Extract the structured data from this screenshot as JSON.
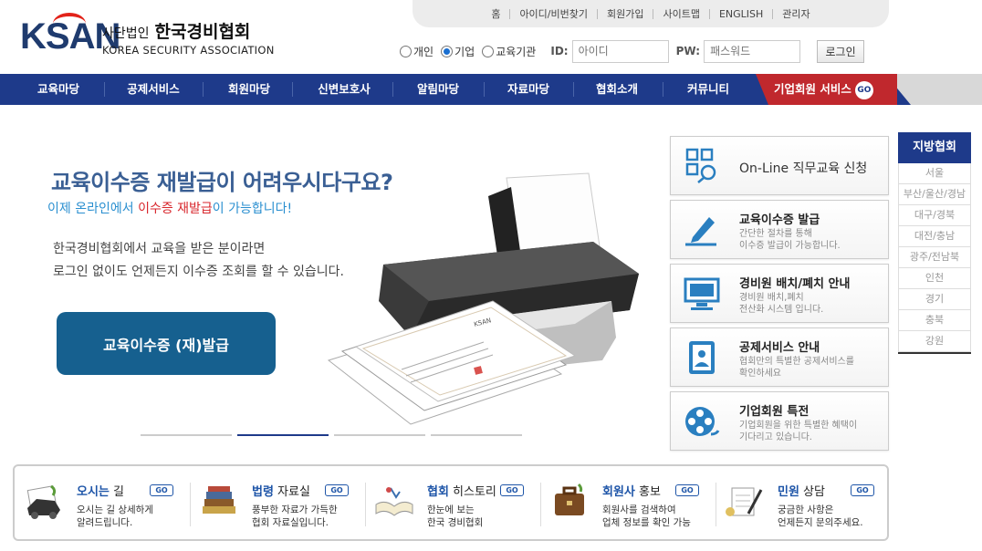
{
  "logo": {
    "ksan": "KSAN",
    "kr_small": "사단법인",
    "kr_name": "한국경비협회",
    "en": "KOREA SECURITY ASSOCIATION"
  },
  "topnav": [
    "홈",
    "아이디/비번찾기",
    "회원가입",
    "사이트맵",
    "ENGLISH",
    "관리자"
  ],
  "login": {
    "types": [
      {
        "label": "개인",
        "selected": false
      },
      {
        "label": "기업",
        "selected": true
      },
      {
        "label": "교육기관",
        "selected": false
      }
    ],
    "id_label": "ID:",
    "id_placeholder": "아이디",
    "pw_label": "PW:",
    "pw_placeholder": "패스워드",
    "button": "로그인"
  },
  "mainnav": [
    "교육마당",
    "공제서비스",
    "회원마당",
    "신변보호사",
    "알림마당",
    "자료마당",
    "협회소개",
    "커뮤니티"
  ],
  "corp_service": {
    "label": "기업회원 서비스",
    "go": "GO"
  },
  "hero": {
    "title": "교육이수증 재발급이 어려우시다구요?",
    "sub_pre": "이제 온라인에서 ",
    "sub_em": "이수증 재발급",
    "sub_post": "이 가능합니다!",
    "desc1": "한국경비협회에서 교육을 받은 분이라면",
    "desc2": "로그인 없이도 언제든지 이수증 조회를 할 수 있습니다.",
    "button": "교육이수증 (재)발급",
    "printer_logo": "KSAN"
  },
  "services": [
    {
      "title": "On-Line 직무교육 신청",
      "desc1": "",
      "desc2": "",
      "icon": "online-icon"
    },
    {
      "title": "교육이수증 발급",
      "desc1": "간단한 절차를 통해",
      "desc2": "이수증 발급이 가능합니다.",
      "icon": "pen-icon"
    },
    {
      "title": "경비원 배치/폐치 안내",
      "desc1": "경비원 배치,폐치",
      "desc2": "전산화 시스템 입니다.",
      "icon": "monitor-icon"
    },
    {
      "title": "공제서비스 안내",
      "desc1": "협회만의 특별한 공제서비스를",
      "desc2": "확인하세요",
      "icon": "book-icon"
    },
    {
      "title": "기업회원 특전",
      "desc1": "기업회원을 위한 특별한 혜택이",
      "desc2": "기다리고 있습니다.",
      "icon": "film-icon"
    }
  ],
  "region": {
    "header": "지방협회",
    "items": [
      "서울",
      "부산/울산/경남",
      "대구/경북",
      "대전/충남",
      "광주/전남북",
      "인천",
      "경기",
      "충북",
      "강원"
    ]
  },
  "bottom": [
    {
      "t1": "오시는",
      "t2": " 길",
      "desc1": "오시는 길 상세하게",
      "desc2": "알려드립니다.",
      "go": "GO"
    },
    {
      "t1": "법령",
      "t2": " 자료실",
      "desc1": "풍부한 자료가 가득한",
      "desc2": "협회 자료실입니다.",
      "go": "GO"
    },
    {
      "t1": "협회",
      "t2": " 히스토리",
      "desc1": "한눈에 보는",
      "desc2": "한국 경비협회",
      "go": "GO"
    },
    {
      "t1": "회원사",
      "t2": " 홍보",
      "desc1": "회원사를 검색하여",
      "desc2": "업체 정보를 확인 가능",
      "go": "GO"
    },
    {
      "t1": "민원",
      "t2": " 상담",
      "desc1": "궁금한 사항은",
      "desc2": "언제든지 문의주세요.",
      "go": "GO"
    }
  ]
}
